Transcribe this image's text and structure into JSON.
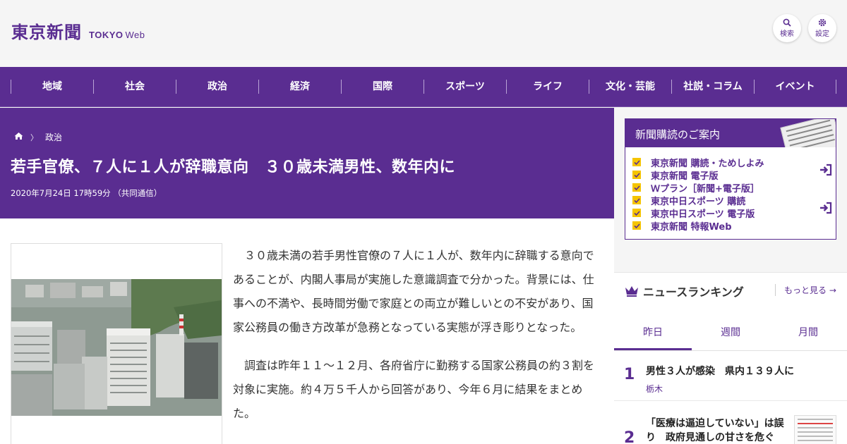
{
  "header": {
    "logo_jp": "東京新聞",
    "logo_en_bold": "TOKYO",
    "logo_en_web": "Web",
    "search_label": "検索",
    "settings_label": "設定"
  },
  "nav": {
    "items": [
      {
        "label": "地域"
      },
      {
        "label": "社会"
      },
      {
        "label": "政治"
      },
      {
        "label": "経済"
      },
      {
        "label": "国際"
      },
      {
        "label": "スポーツ"
      },
      {
        "label": "ライフ"
      },
      {
        "label": "文化・芸能"
      },
      {
        "label": "社説・コラム"
      },
      {
        "label": "イベント"
      }
    ]
  },
  "article": {
    "breadcrumb_section": "政治",
    "title": "若手官僚、７人に１人が辞職意向　３０歳未満男性、数年内に",
    "date": "2020年7月24日 17時59分 （共同通信）",
    "paragraphs": [
      "３０歳未満の若手男性官僚の７人に１人が、数年内に辞職する意向であることが、内閣人事局が実施した意識調査で分かった。背景には、仕事への不満や、長時間労働で家庭との両立が難しいとの不安があり、国家公務員の働き方改革が急務となっている実態が浮き彫りとなった。",
      "調査は昨年１１～１２月、各府省庁に勤務する国家公務員の約３割を対象に実施。約４万５千人から回答があり、今年６月に結果をまとめた。"
    ]
  },
  "subscription": {
    "heading": "新聞購読のご案内",
    "items": [
      {
        "label": "東京新聞 購読・ためしよみ"
      },
      {
        "label": "東京新聞 電子版"
      },
      {
        "label": "Ｗプラン［新聞+電子版］"
      },
      {
        "label": "東京中日スポーツ 購読"
      },
      {
        "label": "東京中日スポーツ 電子版"
      },
      {
        "label": "東京新聞 特報Web"
      }
    ]
  },
  "ranking": {
    "heading": "ニュースランキング",
    "more": "もっと見る",
    "tabs": [
      {
        "label": "昨日"
      },
      {
        "label": "週間"
      },
      {
        "label": "月間"
      }
    ],
    "items": [
      {
        "rank": "1",
        "title": "男性３人が感染　県内１３９人に",
        "category": "栃木"
      },
      {
        "rank": "2",
        "title": "「医療は逼迫していない」は誤り　政府見通しの甘さを危ぐ",
        "category": ""
      }
    ]
  },
  "colors": {
    "brand_purple": "#5a2d91",
    "accent_yellow": "#f5c400"
  }
}
